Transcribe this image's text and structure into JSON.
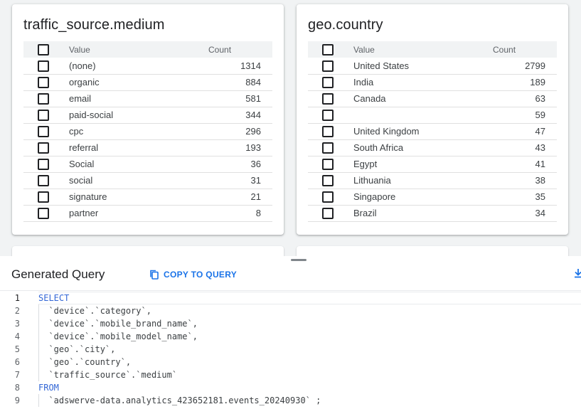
{
  "facet_cards": [
    {
      "title": "traffic_source.medium",
      "header": {
        "value": "Value",
        "count": "Count"
      },
      "rows": [
        {
          "value": "(none)",
          "count": "1314"
        },
        {
          "value": "organic",
          "count": "884"
        },
        {
          "value": "email",
          "count": "581"
        },
        {
          "value": "paid-social",
          "count": "344"
        },
        {
          "value": "cpc",
          "count": "296"
        },
        {
          "value": "referral",
          "count": "193"
        },
        {
          "value": "Social",
          "count": "36"
        },
        {
          "value": "social",
          "count": "31"
        },
        {
          "value": "signature",
          "count": "21"
        },
        {
          "value": "partner",
          "count": "8"
        }
      ]
    },
    {
      "title": "geo.country",
      "header": {
        "value": "Value",
        "count": "Count"
      },
      "rows": [
        {
          "value": "United States",
          "count": "2799"
        },
        {
          "value": "India",
          "count": "189"
        },
        {
          "value": "Canada",
          "count": "63"
        },
        {
          "value": "",
          "count": "59"
        },
        {
          "value": "United Kingdom",
          "count": "47"
        },
        {
          "value": "South Africa",
          "count": "43"
        },
        {
          "value": "Egypt",
          "count": "41"
        },
        {
          "value": "Lithuania",
          "count": "38"
        },
        {
          "value": "Singapore",
          "count": "35"
        },
        {
          "value": "Brazil",
          "count": "34"
        }
      ]
    }
  ],
  "query_panel": {
    "title": "Generated Query",
    "copy_label": "COPY TO QUERY",
    "icons": {
      "copy": "copy-icon",
      "download": "download-icon"
    },
    "lines": [
      {
        "num": "1",
        "kw": "SELECT",
        "text": ""
      },
      {
        "num": "2",
        "kw": "",
        "text": "  `device`.`category`,"
      },
      {
        "num": "3",
        "kw": "",
        "text": "  `device`.`mobile_brand_name`,"
      },
      {
        "num": "4",
        "kw": "",
        "text": "  `device`.`mobile_model_name`,"
      },
      {
        "num": "5",
        "kw": "",
        "text": "  `geo`.`city`,"
      },
      {
        "num": "6",
        "kw": "",
        "text": "  `geo`.`country`,"
      },
      {
        "num": "7",
        "kw": "",
        "text": "  `traffic_source`.`medium`"
      },
      {
        "num": "8",
        "kw": "FROM",
        "text": ""
      },
      {
        "num": "9",
        "kw": "",
        "text": "  `adswerve-data.analytics_423652181.events_20240930` ;"
      }
    ]
  },
  "colors": {
    "accent": "#1a73e8",
    "keyword": "#3367d6"
  }
}
